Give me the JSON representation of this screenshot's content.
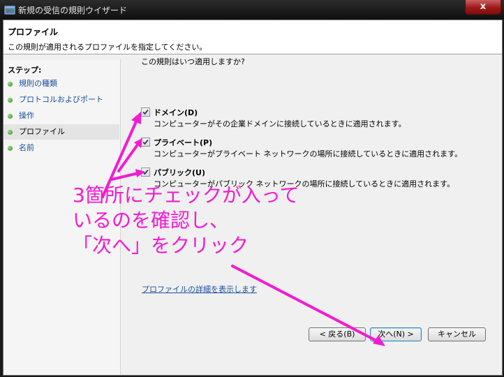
{
  "window": {
    "title": "新規の受信の規則ウイザード",
    "close_label": "x"
  },
  "header": {
    "title": "プロファイル",
    "description": "この規則が適用されるプロファイルを指定してください。"
  },
  "sidebar": {
    "title": "ステップ:",
    "items": [
      {
        "label": "規則の種類"
      },
      {
        "label": "プロトコルおよびポート"
      },
      {
        "label": "操作"
      },
      {
        "label": "プロファイル"
      },
      {
        "label": "名前"
      }
    ]
  },
  "main": {
    "question": "この規則はいつ適用しますか?",
    "options": [
      {
        "label": "ドメイン(D)",
        "description": "コンピューターがその企業ドメインに接続しているときに適用されます。",
        "checked": true
      },
      {
        "label": "プライベート(P)",
        "description": "コンピューターがプライベート ネットワークの場所に接続しているときに適用されます。",
        "checked": true
      },
      {
        "label": "パブリック(U)",
        "description": "コンピューターがパブリック ネットワークの場所に接続しているときに適用されます。",
        "checked": true
      }
    ],
    "link": "プロファイルの詳細を表示します"
  },
  "buttons": {
    "back": "< 戻る(B)",
    "next": "次へ(N) >",
    "cancel": "キャンセル"
  },
  "annotation": {
    "lines": [
      "3箇所にチェックが入って",
      "いるのを確認し、",
      "「次へ」をクリック"
    ],
    "color": "#f21bd2"
  }
}
